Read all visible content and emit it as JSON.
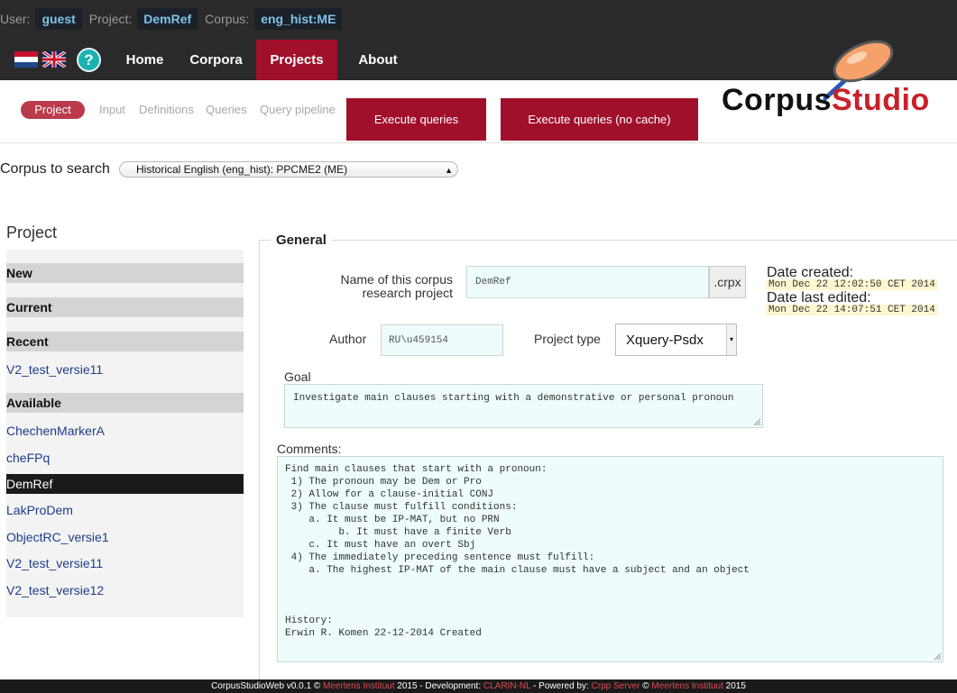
{
  "header": {
    "user_label": "User:",
    "user": "guest",
    "project_label": "Project:",
    "project": "DemRef",
    "corpus_label": "Corpus:",
    "corpus": "eng_hist:ME"
  },
  "nav": {
    "help": "?",
    "items": [
      "Home",
      "Corpora",
      "Projects",
      "About"
    ],
    "active": "Projects"
  },
  "logo": {
    "part1": "Corpus",
    "part2": "Studio"
  },
  "tabs": [
    "Project",
    "Input",
    "Definitions",
    "Queries",
    "Query pipeline"
  ],
  "active_tab": "Project",
  "actions": {
    "execute": "Execute queries",
    "execute_nocache": "Execute queries (no cache)"
  },
  "corpus_search": {
    "label": "Corpus to search",
    "selected": "Historical English (eng_hist): PPCME2 (ME)"
  },
  "sidebar": {
    "title": "Project",
    "new": "New",
    "current": "Current",
    "recent": "Recent",
    "recent_items": [
      "V2_test_versie11"
    ],
    "available": "Available",
    "available_items": [
      "ChechenMarkerA",
      "cheFPq",
      "DemRef",
      "LakProDem",
      "ObjectRC_versie1",
      "V2_test_versie11",
      "V2_test_versie12"
    ],
    "active_item": "DemRef"
  },
  "general": {
    "legend": "General",
    "name_label": "Name of this corpus research project",
    "name_value": "DemRef",
    "ext": ".crpx",
    "date_created_label": "Date created:",
    "date_created": "Mon Dec 22 12:02:50 CET 2014",
    "date_edited_label": "Date last edited:",
    "date_edited": "Mon Dec 22 14:07:51 CET 2014",
    "author_label": "Author",
    "author_value": "RU\\u459154",
    "ptype_label": "Project type",
    "ptype_value": "Xquery-Psdx",
    "goal_label": "Goal",
    "goal_value": "Investigate main clauses starting with a demonstrative or personal pronoun",
    "comments_label": "Comments:",
    "comments_value": "Find main clauses that start with a pronoun:\n 1) The pronoun may be Dem or Pro\n 2) Allow for a clause-initial CONJ\n 3) The clause must fulfill conditions:\n    a. It must be IP-MAT, but no PRN\n         b. It must have a finite Verb\n    c. It must have an overt Sbj\n 4) The immediately preceding sentence must fulfill:\n    a. The highest IP-MAT of the main clause must have a subject and an object\n\n\n\nHistory:\nErwin R. Komen 22-12-2014 Created"
  },
  "footer": {
    "p1": "CorpusStudioWeb v0.0.1 © ",
    "l1": "Meertens Instituut",
    "p2": " 2015 - Development: ",
    "l2": "CLARIN-NL",
    "p3": " - Powered by: ",
    "l3": "Crpp Server",
    "p4": " © ",
    "l4": "Meertens Instituut",
    "p5": " 2015"
  },
  "colors": {
    "accent": "#a0102a",
    "topbar": "#2a2a2a",
    "input_bg": "#eefcfc",
    "link": "#1e3d8c"
  },
  "icons": [
    "flag-nl-icon",
    "flag-uk-icon",
    "help-icon",
    "magnifier-logo-icon",
    "select-arrow-icon",
    "resize-grip-icon"
  ]
}
